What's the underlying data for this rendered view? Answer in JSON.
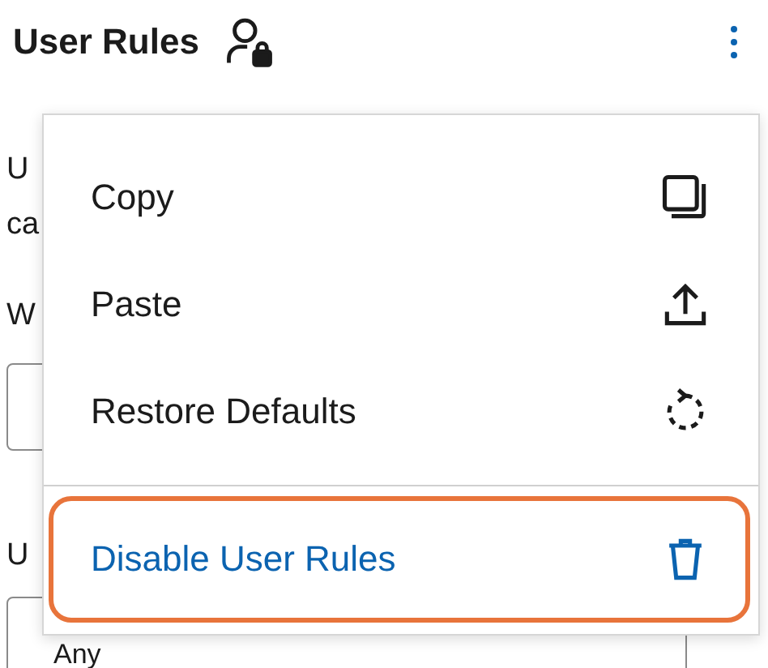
{
  "header": {
    "title": "User Rules"
  },
  "background": {
    "texts": [
      {
        "kind": "label",
        "text": "U"
      },
      {
        "kind": "label",
        "text": "ca"
      },
      {
        "kind": "label",
        "text": "W"
      },
      {
        "kind": "field"
      },
      {
        "kind": "label",
        "text": "U"
      },
      {
        "kind": "select",
        "text": "Any"
      }
    ]
  },
  "menu": {
    "items": [
      {
        "label": "Copy",
        "kind": "copy",
        "danger": false,
        "highlighted": false
      },
      {
        "label": "Paste",
        "kind": "paste",
        "danger": false,
        "highlighted": false
      },
      {
        "label": "Restore Defaults",
        "kind": "restore",
        "danger": false,
        "highlighted": false
      },
      {
        "label": "Disable User Rules",
        "kind": "disable",
        "danger": true,
        "highlighted": true
      }
    ]
  }
}
